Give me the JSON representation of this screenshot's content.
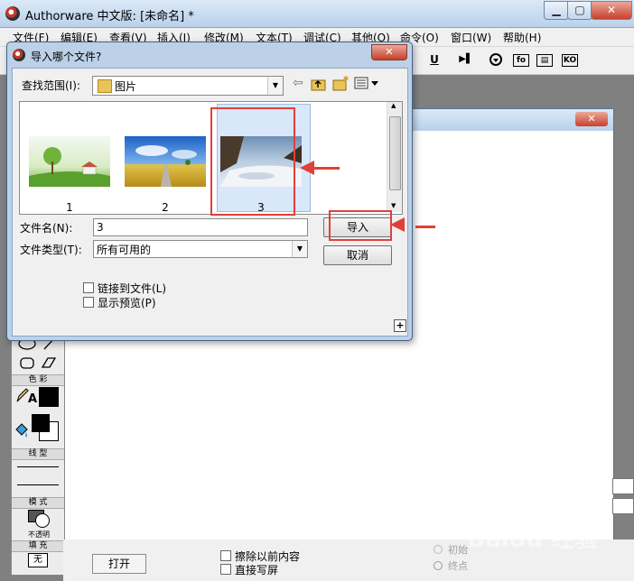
{
  "window": {
    "title": "Authorware 中文版: [未命名] *",
    "min": "▁",
    "max": "▢",
    "close": "✕"
  },
  "menu": [
    "文件(F)",
    "编辑(E)",
    "查看(V)",
    "插入(I)",
    "修改(M)",
    "文本(T)",
    "调试(C)",
    "其他(O)",
    "命令(O)",
    "窗口(W)",
    "帮助(H)"
  ],
  "toolbar": {
    "underline": "U",
    "icons": [
      "▶▌",
      "fo",
      "▤",
      "KO"
    ]
  },
  "dialog": {
    "title": "导入哪个文件?",
    "close": "✕",
    "look_in_label": "查找范围(I):",
    "look_in_value": "图片",
    "files": [
      {
        "name": "1"
      },
      {
        "name": "2"
      },
      {
        "name": "3"
      }
    ],
    "filename_label": "文件名(N):",
    "filename_value": "3",
    "filetype_label": "文件类型(T):",
    "filetype_value": "所有可用的",
    "import_button": "导入",
    "cancel_button": "取消",
    "link_checkbox": "链接到文件(L)",
    "preview_checkbox": "显示预览(P)",
    "plus": "+"
  },
  "palette": {
    "color_label": "色 彩",
    "line_label": "线 型",
    "mode_label": "模 式",
    "mode_value": "不透明",
    "fill_label": "填 充",
    "fill_value": "无",
    "text_a": "A"
  },
  "bottom": {
    "open_button": "打开",
    "erase_checkbox": "擦除以前内容",
    "direct_checkbox": "直接写屏",
    "initial": "初始",
    "end_point": "终点"
  },
  "watermark": "Baidu 经验",
  "colors": {
    "highlight": "#e1403a",
    "titlebar": "#b9d1ea"
  }
}
